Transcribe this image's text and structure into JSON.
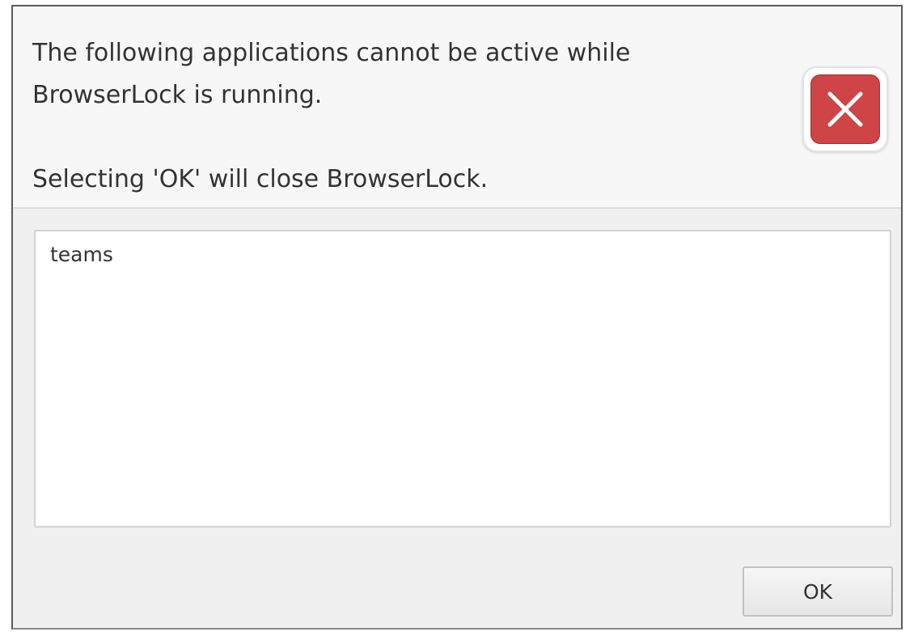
{
  "dialog": {
    "message_line_1": "The following applications cannot be active while",
    "message_line_2": "BrowserLock is running.",
    "message_line_3": "Selecting 'OK' will close BrowserLock.",
    "icon": "close-x-icon",
    "icon_color": "#cf4446"
  },
  "app_list": {
    "items": [
      "teams"
    ]
  },
  "buttons": {
    "ok_label": "OK"
  }
}
